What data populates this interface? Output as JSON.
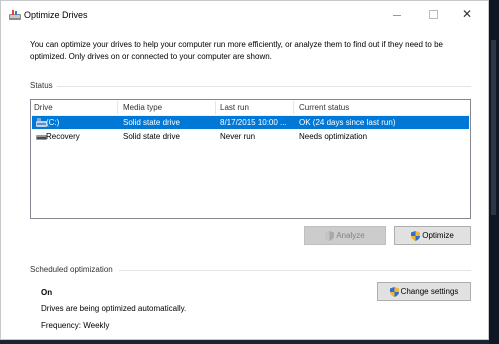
{
  "window": {
    "title": "Optimize Drives",
    "controls": {
      "minimize": "—",
      "maximize": "",
      "close": "✕"
    }
  },
  "intro_text": "You can optimize your drives to help your computer run more efficiently, or analyze them to find out if they need to be optimized. Only drives on or connected to your computer are shown.",
  "status": {
    "label": "Status",
    "columns": [
      "Drive",
      "Media type",
      "Last run",
      "Current status"
    ],
    "rows": [
      {
        "drive": "(C:)",
        "media_type": "Solid state drive",
        "last_run": "8/17/2015 10:00 ...",
        "current_status": "OK (24 days since last run)",
        "selected": true,
        "icon": "system-drive-icon"
      },
      {
        "drive": "Recovery",
        "media_type": "Solid state drive",
        "last_run": "Never run",
        "current_status": "Needs optimization",
        "selected": false,
        "icon": "drive-icon"
      }
    ]
  },
  "buttons": {
    "analyze": "Analyze",
    "optimize": "Optimize",
    "change_settings": "Change settings"
  },
  "scheduled": {
    "label": "Scheduled optimization",
    "state": "On",
    "description": "Drives are being optimized automatically.",
    "frequency": "Frequency: Weekly"
  },
  "colors": {
    "selection": "#0078d7",
    "window_bg": "#ffffff",
    "desktop_bg": "#1a2433"
  }
}
